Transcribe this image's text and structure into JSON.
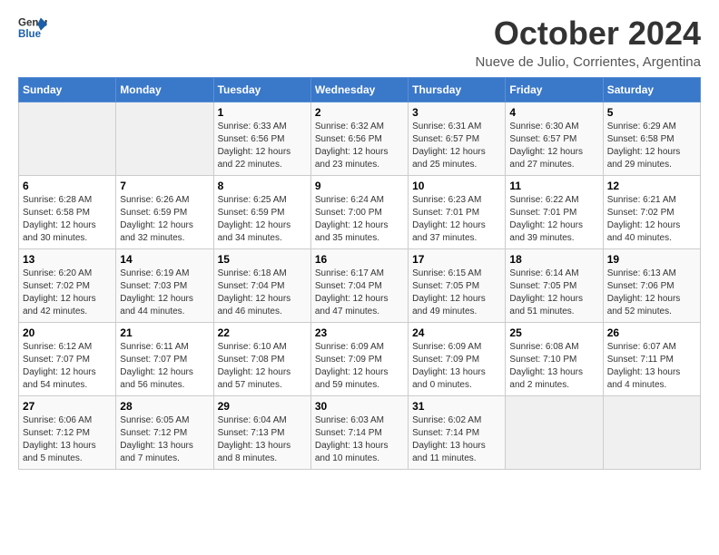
{
  "logo": {
    "line1": "General",
    "line2": "Blue"
  },
  "title": "October 2024",
  "subtitle": "Nueve de Julio, Corrientes, Argentina",
  "headers": [
    "Sunday",
    "Monday",
    "Tuesday",
    "Wednesday",
    "Thursday",
    "Friday",
    "Saturday"
  ],
  "weeks": [
    [
      {
        "day": "",
        "info": ""
      },
      {
        "day": "",
        "info": ""
      },
      {
        "day": "1",
        "info": "Sunrise: 6:33 AM\nSunset: 6:56 PM\nDaylight: 12 hours\nand 22 minutes."
      },
      {
        "day": "2",
        "info": "Sunrise: 6:32 AM\nSunset: 6:56 PM\nDaylight: 12 hours\nand 23 minutes."
      },
      {
        "day": "3",
        "info": "Sunrise: 6:31 AM\nSunset: 6:57 PM\nDaylight: 12 hours\nand 25 minutes."
      },
      {
        "day": "4",
        "info": "Sunrise: 6:30 AM\nSunset: 6:57 PM\nDaylight: 12 hours\nand 27 minutes."
      },
      {
        "day": "5",
        "info": "Sunrise: 6:29 AM\nSunset: 6:58 PM\nDaylight: 12 hours\nand 29 minutes."
      }
    ],
    [
      {
        "day": "6",
        "info": "Sunrise: 6:28 AM\nSunset: 6:58 PM\nDaylight: 12 hours\nand 30 minutes."
      },
      {
        "day": "7",
        "info": "Sunrise: 6:26 AM\nSunset: 6:59 PM\nDaylight: 12 hours\nand 32 minutes."
      },
      {
        "day": "8",
        "info": "Sunrise: 6:25 AM\nSunset: 6:59 PM\nDaylight: 12 hours\nand 34 minutes."
      },
      {
        "day": "9",
        "info": "Sunrise: 6:24 AM\nSunset: 7:00 PM\nDaylight: 12 hours\nand 35 minutes."
      },
      {
        "day": "10",
        "info": "Sunrise: 6:23 AM\nSunset: 7:01 PM\nDaylight: 12 hours\nand 37 minutes."
      },
      {
        "day": "11",
        "info": "Sunrise: 6:22 AM\nSunset: 7:01 PM\nDaylight: 12 hours\nand 39 minutes."
      },
      {
        "day": "12",
        "info": "Sunrise: 6:21 AM\nSunset: 7:02 PM\nDaylight: 12 hours\nand 40 minutes."
      }
    ],
    [
      {
        "day": "13",
        "info": "Sunrise: 6:20 AM\nSunset: 7:02 PM\nDaylight: 12 hours\nand 42 minutes."
      },
      {
        "day": "14",
        "info": "Sunrise: 6:19 AM\nSunset: 7:03 PM\nDaylight: 12 hours\nand 44 minutes."
      },
      {
        "day": "15",
        "info": "Sunrise: 6:18 AM\nSunset: 7:04 PM\nDaylight: 12 hours\nand 46 minutes."
      },
      {
        "day": "16",
        "info": "Sunrise: 6:17 AM\nSunset: 7:04 PM\nDaylight: 12 hours\nand 47 minutes."
      },
      {
        "day": "17",
        "info": "Sunrise: 6:15 AM\nSunset: 7:05 PM\nDaylight: 12 hours\nand 49 minutes."
      },
      {
        "day": "18",
        "info": "Sunrise: 6:14 AM\nSunset: 7:05 PM\nDaylight: 12 hours\nand 51 minutes."
      },
      {
        "day": "19",
        "info": "Sunrise: 6:13 AM\nSunset: 7:06 PM\nDaylight: 12 hours\nand 52 minutes."
      }
    ],
    [
      {
        "day": "20",
        "info": "Sunrise: 6:12 AM\nSunset: 7:07 PM\nDaylight: 12 hours\nand 54 minutes."
      },
      {
        "day": "21",
        "info": "Sunrise: 6:11 AM\nSunset: 7:07 PM\nDaylight: 12 hours\nand 56 minutes."
      },
      {
        "day": "22",
        "info": "Sunrise: 6:10 AM\nSunset: 7:08 PM\nDaylight: 12 hours\nand 57 minutes."
      },
      {
        "day": "23",
        "info": "Sunrise: 6:09 AM\nSunset: 7:09 PM\nDaylight: 12 hours\nand 59 minutes."
      },
      {
        "day": "24",
        "info": "Sunrise: 6:09 AM\nSunset: 7:09 PM\nDaylight: 13 hours\nand 0 minutes."
      },
      {
        "day": "25",
        "info": "Sunrise: 6:08 AM\nSunset: 7:10 PM\nDaylight: 13 hours\nand 2 minutes."
      },
      {
        "day": "26",
        "info": "Sunrise: 6:07 AM\nSunset: 7:11 PM\nDaylight: 13 hours\nand 4 minutes."
      }
    ],
    [
      {
        "day": "27",
        "info": "Sunrise: 6:06 AM\nSunset: 7:12 PM\nDaylight: 13 hours\nand 5 minutes."
      },
      {
        "day": "28",
        "info": "Sunrise: 6:05 AM\nSunset: 7:12 PM\nDaylight: 13 hours\nand 7 minutes."
      },
      {
        "day": "29",
        "info": "Sunrise: 6:04 AM\nSunset: 7:13 PM\nDaylight: 13 hours\nand 8 minutes."
      },
      {
        "day": "30",
        "info": "Sunrise: 6:03 AM\nSunset: 7:14 PM\nDaylight: 13 hours\nand 10 minutes."
      },
      {
        "day": "31",
        "info": "Sunrise: 6:02 AM\nSunset: 7:14 PM\nDaylight: 13 hours\nand 11 minutes."
      },
      {
        "day": "",
        "info": ""
      },
      {
        "day": "",
        "info": ""
      }
    ]
  ]
}
